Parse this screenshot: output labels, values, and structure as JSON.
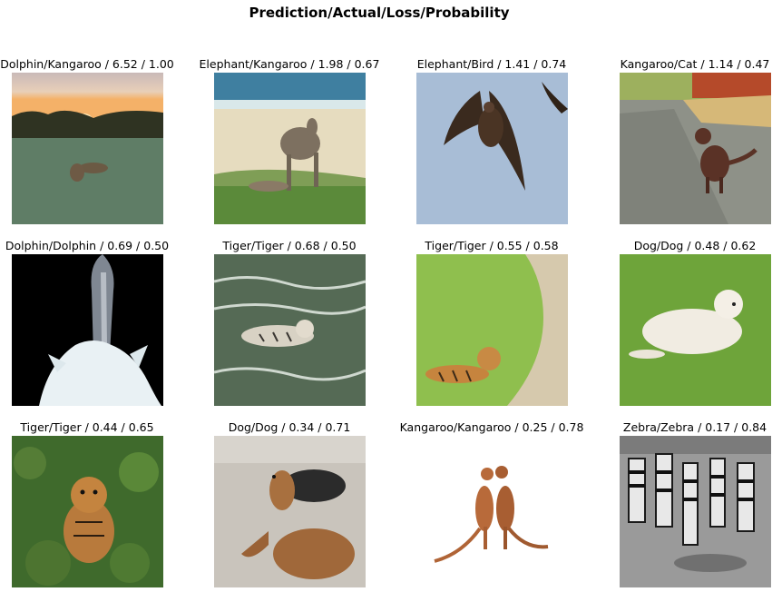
{
  "figure_title": "Prediction/Actual/Loss/Probability",
  "grid": [
    {
      "caption": "Dolphin/Kangaroo / 6.52 / 1.00",
      "scene": "kangaroos-at-sunset"
    },
    {
      "caption": "Elephant/Kangaroo / 1.98 / 0.67",
      "scene": "kangaroos-on-beach"
    },
    {
      "caption": "Elephant/Bird / 1.41 / 0.74",
      "scene": "bird-in-flight"
    },
    {
      "caption": "Kangaroo/Cat / 1.14 / 0.47",
      "scene": "cat-on-road"
    },
    {
      "caption": "Dolphin/Dolphin / 0.69 / 0.50",
      "scene": "dolphin-leaping"
    },
    {
      "caption": "Tiger/Tiger / 0.68 / 0.50",
      "scene": "tiger-swimming"
    },
    {
      "caption": "Tiger/Tiger / 0.55 / 0.58",
      "scene": "tiger-in-green-pool"
    },
    {
      "caption": "Dog/Dog / 0.48 / 0.62",
      "scene": "white-dog-on-grass"
    },
    {
      "caption": "Tiger/Tiger / 0.44 / 0.65",
      "scene": "tiger-cub-in-foliage"
    },
    {
      "caption": "Dog/Dog / 0.34 / 0.71",
      "scene": "brown-dogs-lying"
    },
    {
      "caption": "Kangaroo/Kangaroo / 0.25 / 0.78",
      "scene": "kangaroos-boxing"
    },
    {
      "caption": "Zebra/Zebra / 0.17 / 0.84",
      "scene": "zebra-herd-grayscale"
    }
  ]
}
